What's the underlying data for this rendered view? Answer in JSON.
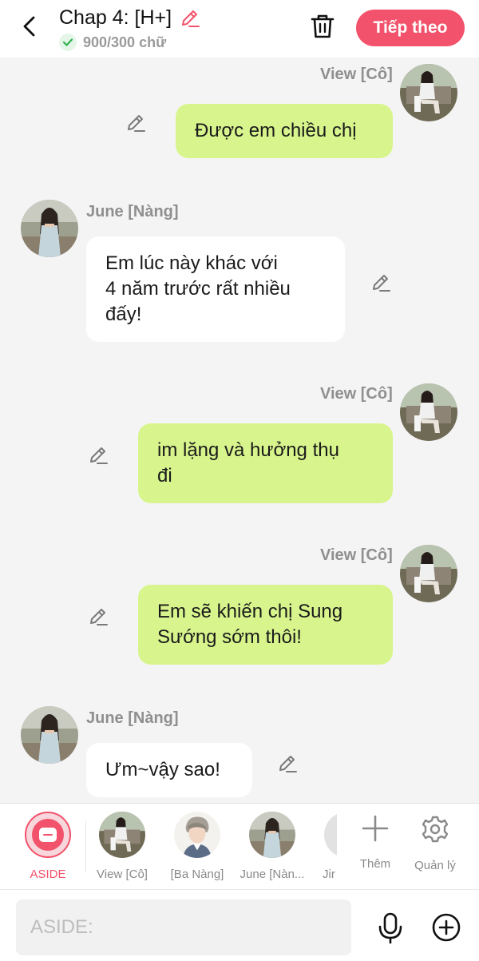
{
  "header": {
    "title": "Chap 4: [H+]",
    "word_count": "900/300 chữ",
    "next_label": "Tiếp theo"
  },
  "messages": [
    {
      "side": "me",
      "sender": "View [Cô]",
      "text": "Được em chiều chị"
    },
    {
      "side": "other",
      "sender": "June [Nàng]",
      "text_lines": [
        "Em lúc này khác với",
        "4 năm trước rất nhiều",
        "đấy!"
      ]
    },
    {
      "side": "me",
      "sender": "View [Cô]",
      "text_lines": [
        "im lặng và hưởng thụ",
        "đi"
      ]
    },
    {
      "side": "me",
      "sender": "View [Cô]",
      "text_lines": [
        "Em sẽ khiến chị Sung",
        "Sướng sớm thôi!"
      ]
    },
    {
      "side": "other",
      "sender": "June [Nàng]",
      "text": "Ưm~vậy sao!"
    }
  ],
  "characters": [
    {
      "label": "ASIDE",
      "active": true
    },
    {
      "label": "View [Cô]"
    },
    {
      "label": "[Ba Nàng]"
    },
    {
      "label": "June [Nàn..."
    },
    {
      "label": "Jir"
    }
  ],
  "actions": {
    "more_label": "Thêm",
    "manage_label": "Quản lý"
  },
  "composer": {
    "placeholder": "ASIDE:"
  },
  "colors": {
    "accent": "#f2526b",
    "me_bubble": "#d8f58d",
    "other_bubble": "#ffffff",
    "check": "#2fb350"
  },
  "icons": [
    "back-arrow-icon",
    "pencil-icon",
    "check-icon",
    "trash-icon",
    "aside-icon",
    "plus-icon",
    "gear-icon",
    "mic-icon",
    "plus-circle-icon"
  ]
}
